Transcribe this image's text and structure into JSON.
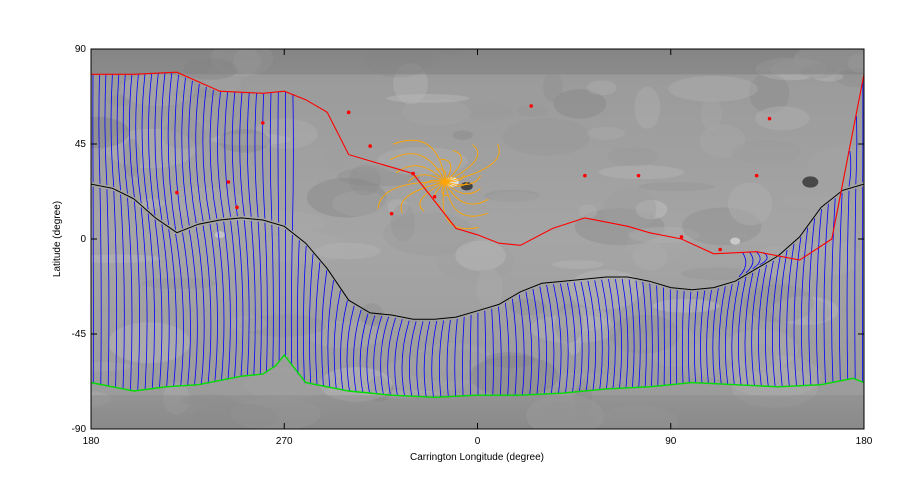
{
  "chart_data": {
    "type": "line",
    "title": "",
    "xlabel": "Carrington Longitude (degree)",
    "ylabel": "Latitude (degree)",
    "x_tick_labels": [
      "180",
      "270",
      "0",
      "90",
      "180"
    ],
    "y_tick_labels": [
      "90",
      "45",
      "0",
      "-45",
      "-90"
    ],
    "y_ticks": [
      90,
      45,
      0,
      -45,
      -90
    ],
    "x_ticks_shifted": [
      0,
      90,
      180,
      270,
      360
    ],
    "xlim_shifted": [
      0,
      360
    ],
    "ylim": [
      -90,
      90
    ],
    "background": "grayscale magnetogram",
    "grid": false,
    "legend": "none",
    "colors": {
      "open_field_lines": "#0000ff",
      "closed_loops": "#ffa500",
      "positive_contour": "#ff0000",
      "negative_contour": "#00dd00",
      "neutral_line": "#000000",
      "background": "#9a9a9a"
    },
    "series": [
      {
        "role": "neutral-line",
        "x_shifted": [
          0,
          10,
          20,
          30,
          40,
          50,
          60,
          70,
          80,
          90,
          100,
          110,
          120,
          130,
          140,
          150,
          160,
          170,
          180,
          190,
          200,
          210,
          220,
          230,
          240,
          250,
          260,
          270,
          280,
          290,
          300,
          310,
          320,
          330,
          340,
          350,
          360
        ],
        "y": [
          26,
          24,
          19,
          10,
          3,
          7,
          9,
          10,
          9,
          6,
          -2,
          -14,
          -29,
          -35,
          -36,
          -38,
          -38,
          -37,
          -34,
          -31,
          -25,
          -21,
          -20,
          -19,
          -18,
          -18,
          -20,
          -23,
          -24,
          -23,
          -20,
          -14,
          -8,
          1,
          15,
          23,
          26
        ]
      },
      {
        "role": "positive-boundary",
        "x_shifted": [
          0,
          20,
          40,
          60,
          80,
          90,
          100,
          110,
          120,
          150,
          170,
          180,
          190,
          200,
          215,
          230,
          250,
          260,
          275,
          290,
          310,
          330,
          345,
          360
        ],
        "y": [
          78,
          78,
          79,
          70,
          69,
          70,
          66,
          60,
          40,
          31,
          5,
          2,
          -2,
          -3,
          5,
          10,
          6,
          3,
          0,
          -7,
          -6,
          -10,
          0,
          78
        ]
      },
      {
        "role": "negative-boundary",
        "x_shifted": [
          0,
          10,
          20,
          35,
          50,
          60,
          70,
          80,
          86,
          90,
          100,
          120,
          140,
          160,
          180,
          200,
          220,
          240,
          260,
          280,
          300,
          320,
          340,
          355,
          360
        ],
        "y": [
          -68,
          -70,
          -72,
          -70,
          -69,
          -67,
          -65,
          -64,
          -60,
          -55,
          -68,
          -72,
          -74,
          -75,
          -74,
          -74,
          -73,
          -71,
          -70,
          -68,
          -69,
          -70,
          -69,
          -66,
          -68
        ]
      }
    ]
  }
}
